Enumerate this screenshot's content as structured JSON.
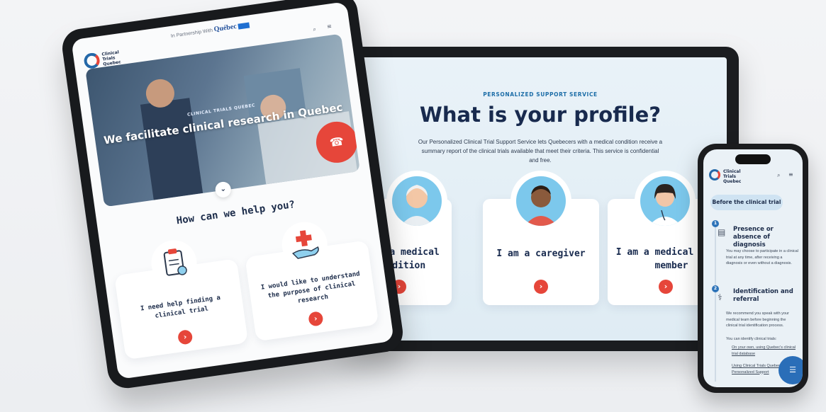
{
  "tablet": {
    "partner_text": "In Partnership With",
    "partner_brand": "Québec",
    "logo_lines": [
      "Clinical",
      "Trials",
      "Quebec"
    ],
    "hero_kicker": "CLINICAL TRIALS QUEBEC",
    "hero_title": "We facilitate clinical research in Quebec",
    "help_title": "How can we help you?",
    "cards": [
      {
        "label": "I need help finding a clinical trial"
      },
      {
        "label": "I would like to understand the purpose of clinical research"
      }
    ]
  },
  "monitor": {
    "kicker": "PERSONALIZED SUPPORT SERVICE",
    "title": "What is your profile?",
    "description": "Our Personalized Clinical Trial Support Service lets Quebecers with a medical condition receive a summary report of the clinical trials available that meet their criteria. This service is confidential and free.",
    "profiles": [
      {
        "label": "have a medical condition"
      },
      {
        "label": "I am a caregiver"
      },
      {
        "label": "I am a medical staff member"
      }
    ]
  },
  "phone": {
    "logo_lines": [
      "Clinical",
      "Trials",
      "Quebec"
    ],
    "pill": "Before the clinical trial",
    "steps": [
      {
        "num": "1",
        "title": "Presence or absence of diagnosis",
        "desc": "You may choose to participate in a clinical trial at any time, after receiving a diagnosis or even without a diagnosis."
      },
      {
        "num": "2",
        "title": "Identification and referral",
        "desc": "We recommend you speak with your medical team before beginning the clinical trial identification process.",
        "desc2": "You can identify clinical trials:",
        "bullets": [
          "On your own, using Quebec's clinical trial database",
          "Using Clinical Trials Quebec's Personalized Support"
        ]
      }
    ]
  },
  "colors": {
    "accent_red": "#e6463a",
    "navy": "#182a4e",
    "blue": "#2468a8"
  }
}
